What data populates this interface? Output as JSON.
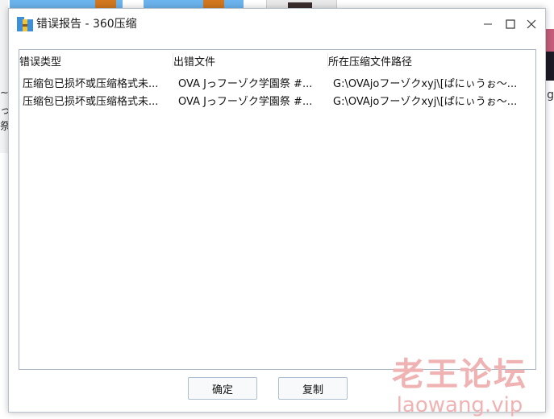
{
  "window": {
    "title": "错误报告 - 360压缩",
    "minimize_glyph": "—",
    "maximize_glyph": "☐",
    "close_glyph": "✕"
  },
  "icons": {
    "app": "360zip-archive-icon",
    "minimize": "minimize-icon",
    "maximize": "maximize-icon",
    "close": "close-icon"
  },
  "list": {
    "columns": [
      "错误类型",
      "出错文件",
      "所在压缩文件路径"
    ],
    "rows": [
      [
        "压缩包已损坏或压缩格式未...",
        "OVA Jっフーゾク学園祭 #...",
        "G:\\OVAjoフーゾクxyj\\[ぱにぃうぉ～..."
      ],
      [
        "压缩包已损坏或压缩格式未...",
        "OVA Jっフーゾク学園祭 #...",
        "G:\\OVAjoフーゾクxyj\\[ぱにぃうぉ～..."
      ]
    ]
  },
  "buttons": {
    "ok": "确定",
    "copy": "复制"
  },
  "watermark": {
    "cn": "老王论坛",
    "en": "laowang.vip"
  },
  "background": {
    "left_chars": [
      "~",
      "っ",
      "祭"
    ],
    "right_char": "g"
  },
  "colors": {
    "folder": "#6cb4ee",
    "folder_tab": "#d1771f",
    "watermark": "#f0b3b3",
    "list_border": "#a8b6c3"
  }
}
